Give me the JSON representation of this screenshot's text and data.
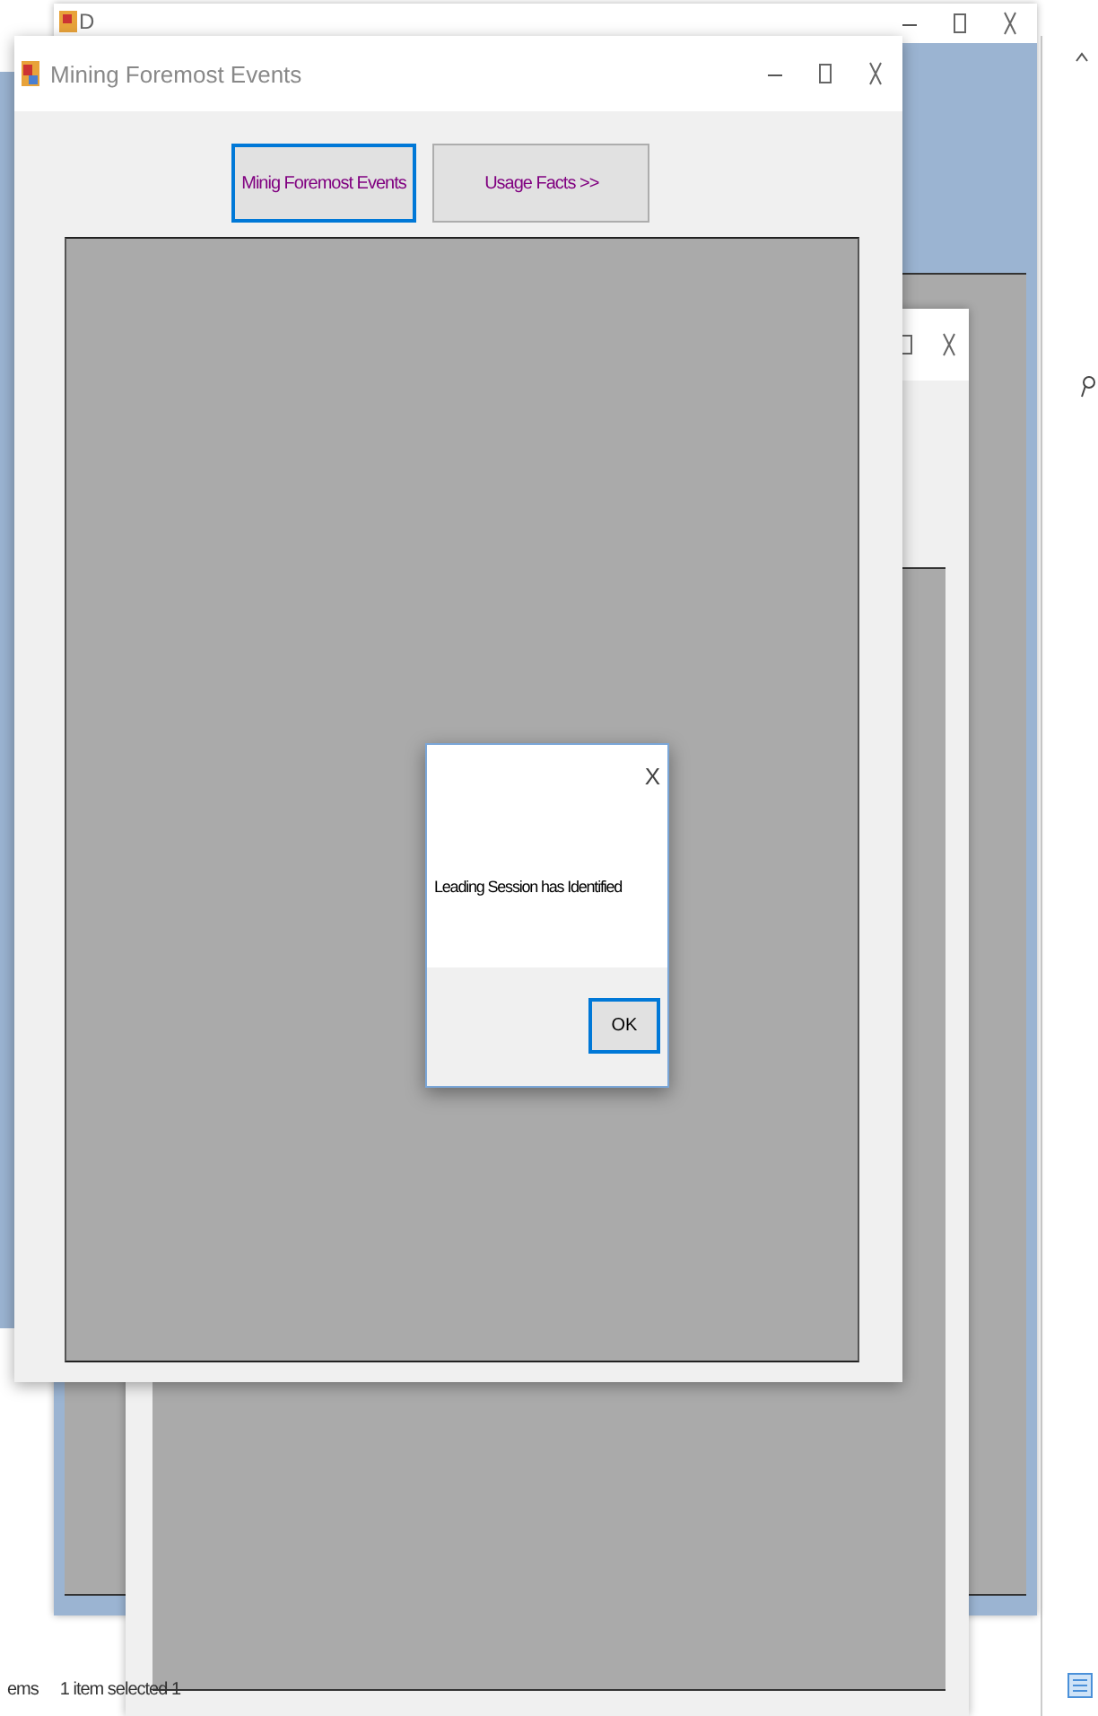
{
  "back_window": {
    "title": "D"
  },
  "main_window": {
    "title": "Mining Foremost Events",
    "tabs": [
      {
        "label": "Minig Foremost Events",
        "selected": true
      },
      {
        "label": "Usage Facts >>",
        "selected": false
      }
    ]
  },
  "message_box": {
    "close": "X",
    "message": "Leading Session has Identified",
    "button": "OK"
  },
  "status_bar": [
    "ems",
    "1 item selected 1"
  ]
}
